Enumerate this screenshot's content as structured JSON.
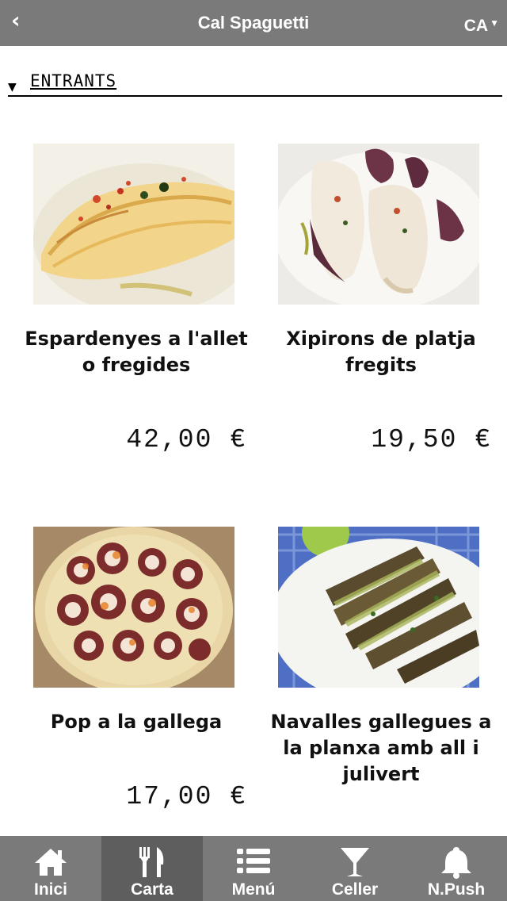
{
  "header": {
    "back_glyph": "‹",
    "title": "Cal Spaguetti",
    "language": "CA",
    "language_caret": "▼"
  },
  "section": {
    "arrow_glyph": "▼",
    "label": "ENTRANTS"
  },
  "items": [
    {
      "name_line1": "Espardenyes a l'allet",
      "name_line2": "o fregides",
      "name_line3": "",
      "price": "42,00 €",
      "photo": "espardenyes-photo"
    },
    {
      "name_line1": "Xipirons de platja",
      "name_line2": "fregits",
      "name_line3": "",
      "price": "19,50 €",
      "photo": "xipirons-photo"
    },
    {
      "name_line1": "Pop a la gallega",
      "name_line2": "",
      "name_line3": "",
      "price": "17,00 €",
      "photo": "pop-photo"
    },
    {
      "name_line1": "Navalles gallegues a",
      "name_line2": "la planxa amb all i",
      "name_line3": "julivert",
      "price": "",
      "photo": "navalles-photo"
    }
  ],
  "tabs": [
    {
      "label": "Inici",
      "icon": "home-icon",
      "active": false
    },
    {
      "label": "Carta",
      "icon": "fork-knife-icon",
      "active": true
    },
    {
      "label": "Menú",
      "icon": "list-icon",
      "active": false
    },
    {
      "label": "Celler",
      "icon": "cocktail-glass-icon",
      "active": false
    },
    {
      "label": "N.Push",
      "icon": "bell-icon",
      "active": false
    }
  ]
}
